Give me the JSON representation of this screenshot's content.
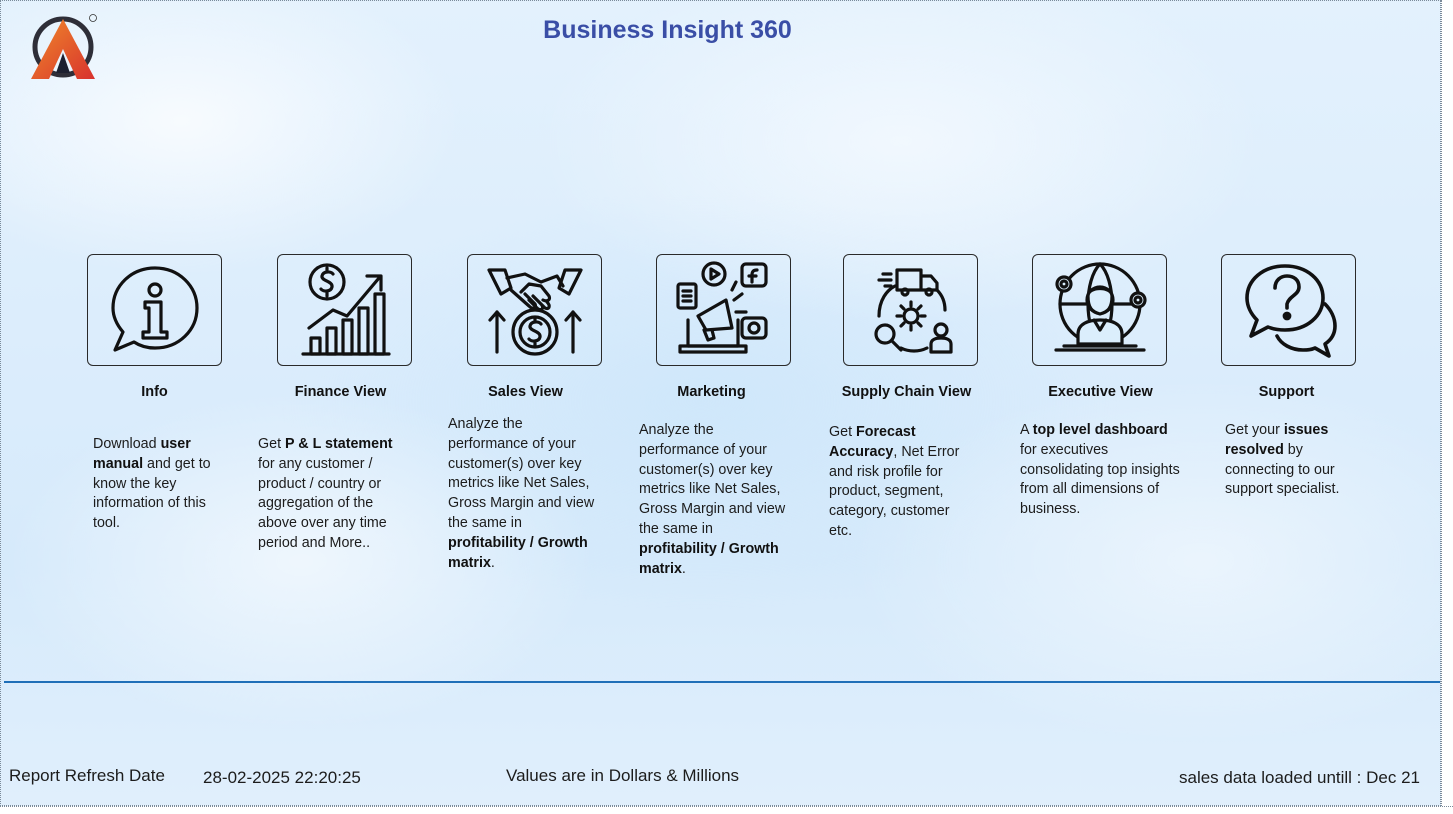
{
  "header": {
    "title": "Business Insight 360",
    "logo_mark": "®"
  },
  "cards": [
    {
      "title": "Info",
      "icon": "info-icon",
      "desc_parts": [
        " Download ",
        "user manual",
        " and get to know the key information of this tool."
      ]
    },
    {
      "title": "Finance View",
      "icon": "finance-growth-icon",
      "desc_parts": [
        "Get  ",
        "P & L statement",
        " for any customer / product / country or aggregation of the above over any time period and More.."
      ]
    },
    {
      "title": "Sales View",
      "icon": "handshake-dollar-icon",
      "desc_parts": [
        "Analyze the performance of your customer(s) over key metrics like Net Sales, Gross Margin and view the same in ",
        "profitability / Growth matrix",
        "."
      ]
    },
    {
      "title": "Marketing",
      "icon": "megaphone-icon",
      "desc_parts": [
        "Analyze the performance of your customer(s) over key metrics like Net Sales, Gross Margin and view the same in ",
        "profitability / Growth matrix",
        "."
      ]
    },
    {
      "title": "Supply Chain View",
      "icon": "supply-chain-icon",
      "desc_parts": [
        " Get ",
        "Forecast Accuracy",
        ", Net Error and risk profile for product, segment, category, customer etc."
      ]
    },
    {
      "title": "Executive View",
      "icon": "executive-icon",
      "desc_parts": [
        "A ",
        "top level dashboard",
        " for executives consolidating top insights from all dimensions of business."
      ]
    },
    {
      "title": "Support",
      "icon": "support-chat-icon",
      "desc_parts": [
        " Get your ",
        "issues resolved",
        " by connecting to our support specialist."
      ]
    }
  ],
  "footer": {
    "refresh_label": "Report Refresh Date",
    "refresh_value": "28-02-2025 22:20:25",
    "units_note": "Values are in Dollars & Millions",
    "data_loaded": "sales data loaded untill : Dec 21"
  },
  "colors": {
    "title": "#3a4ea6",
    "divider": "#1f6fb8",
    "logo_orange": "#e8562a",
    "logo_red": "#d8322e"
  }
}
